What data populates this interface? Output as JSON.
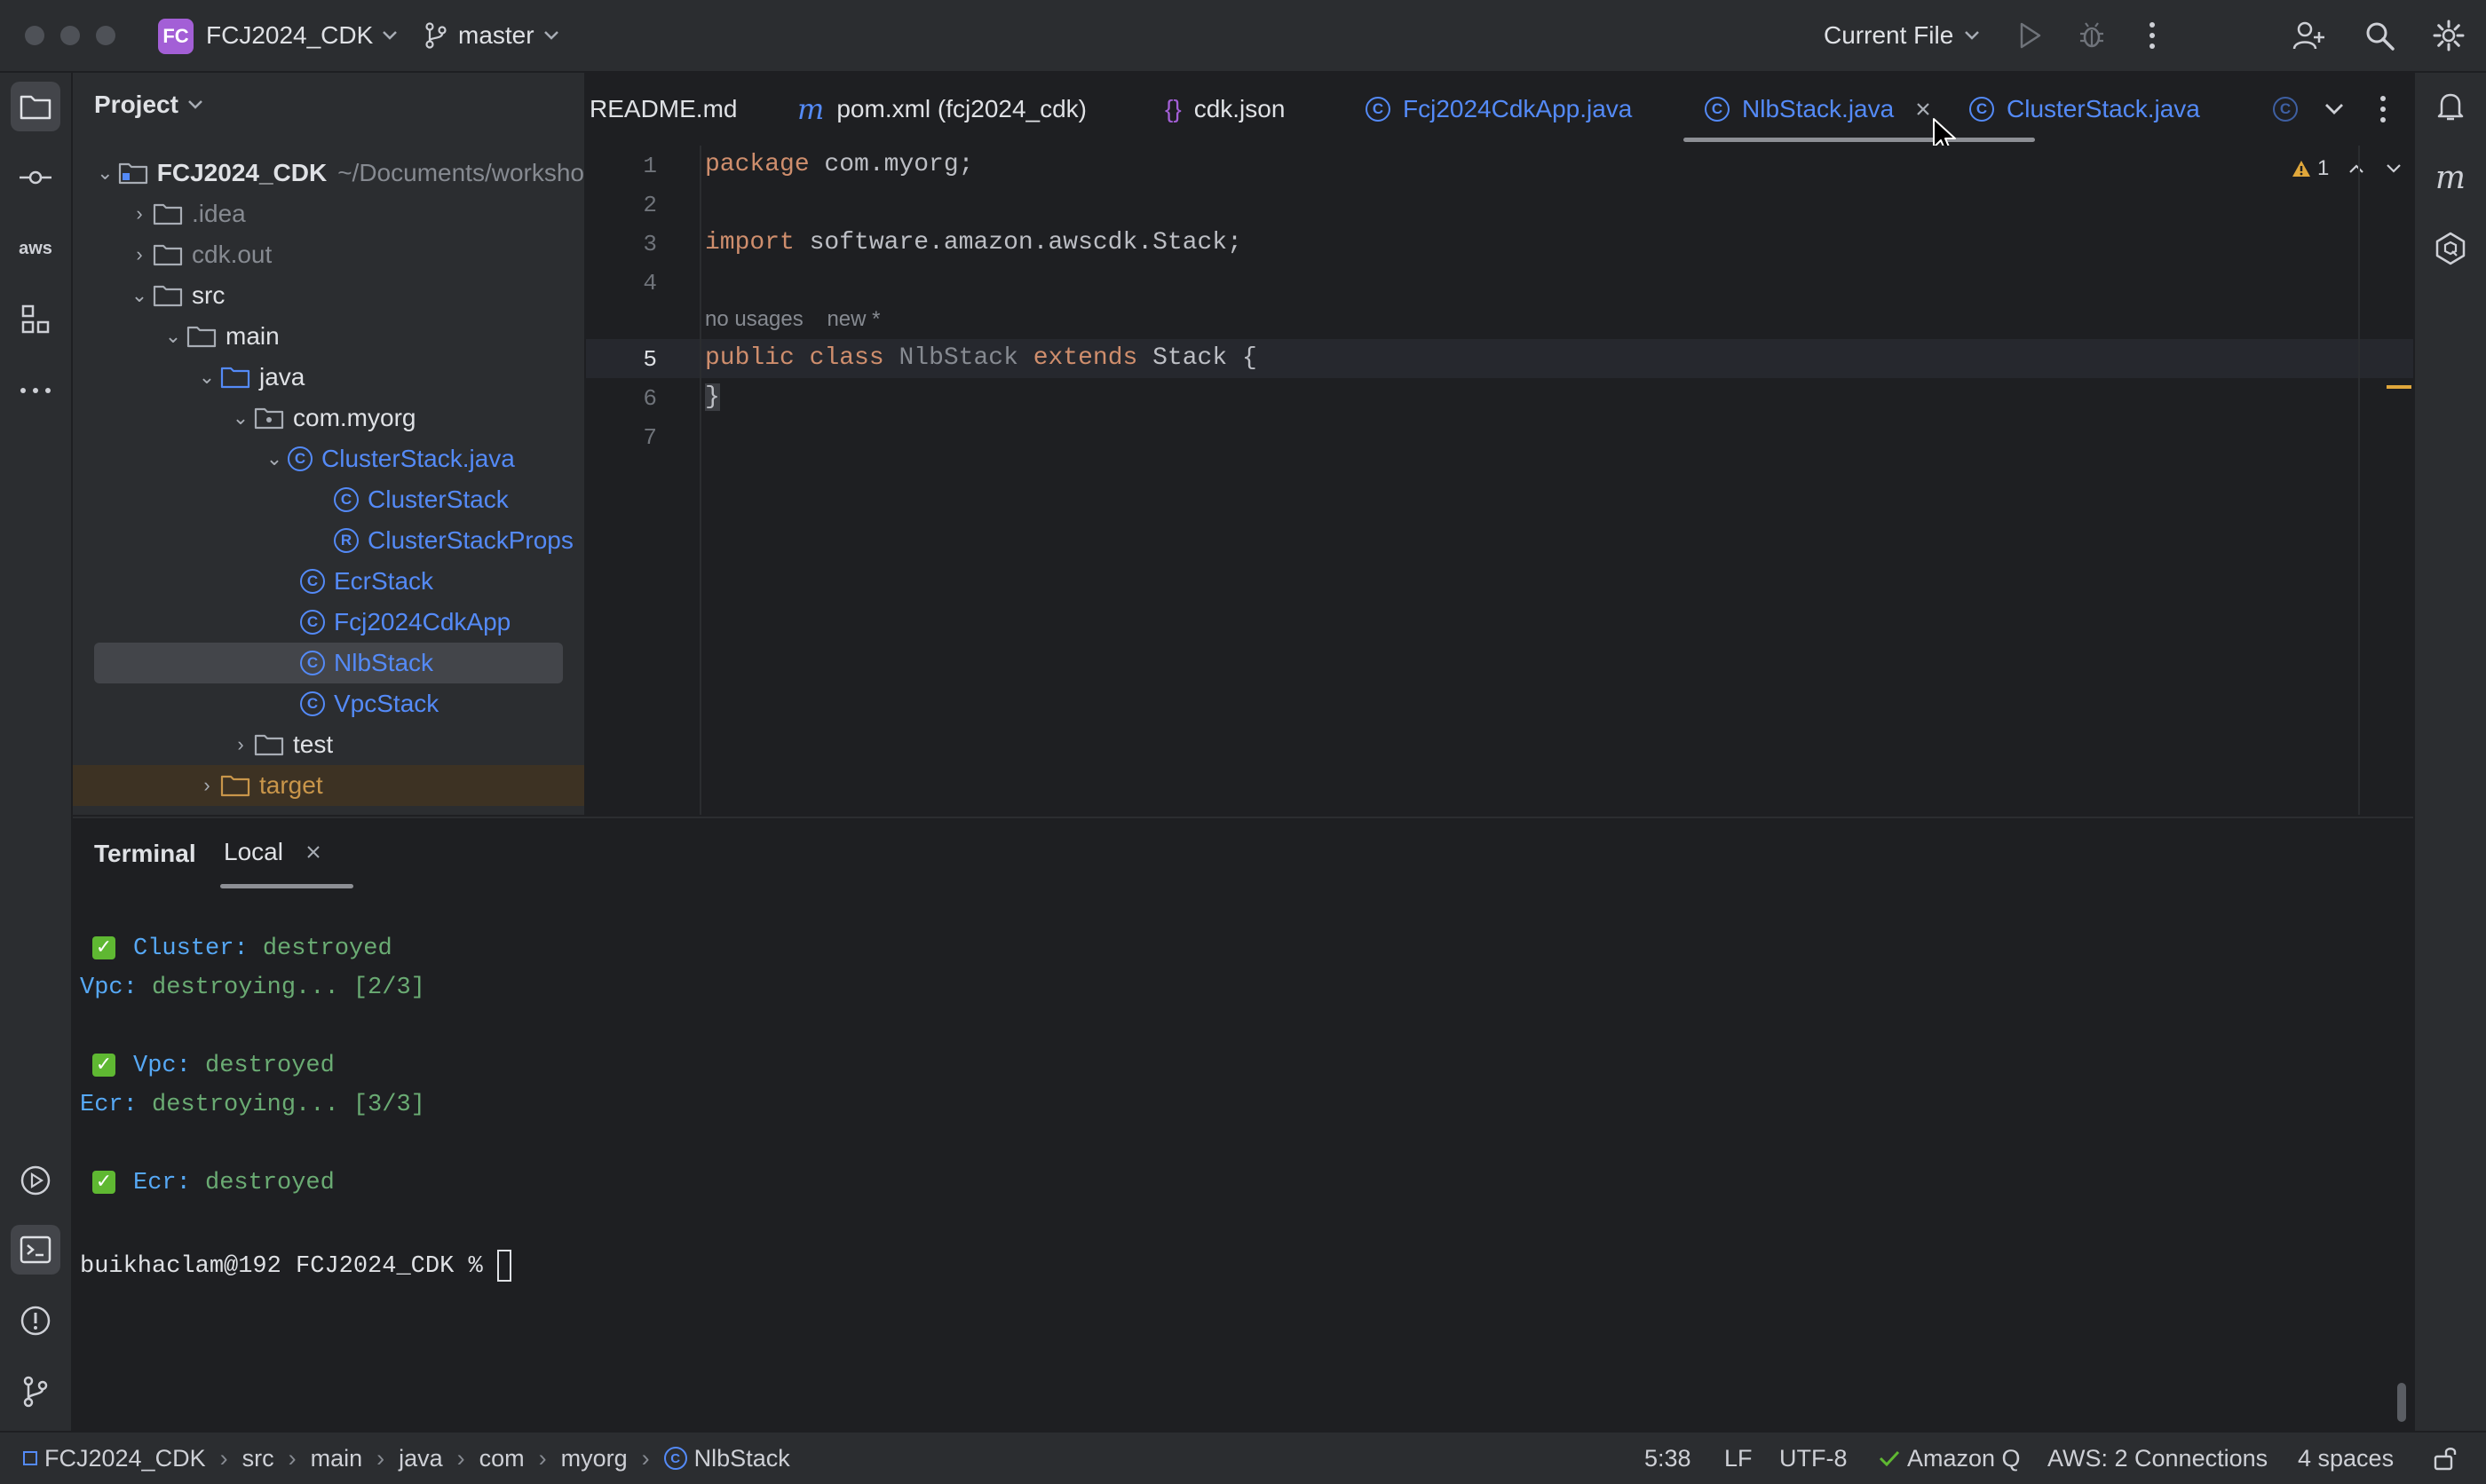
{
  "titlebar": {
    "project_badge": "FC",
    "project_name": "FCJ2024_CDK",
    "branch": "master",
    "run_config": "Current File"
  },
  "project_panel": {
    "title": "Project",
    "root_name": "FCJ2024_CDK",
    "root_path": "~/Documents/worksho",
    "items": [
      {
        "label": ".idea"
      },
      {
        "label": "cdk.out"
      },
      {
        "label": "src"
      },
      {
        "label": "main"
      },
      {
        "label": "java"
      },
      {
        "label": "com.myorg"
      },
      {
        "label": "ClusterStack.java"
      },
      {
        "label": "ClusterStack"
      },
      {
        "label": "ClusterStackProps"
      },
      {
        "label": "EcrStack"
      },
      {
        "label": "Fcj2024CdkApp"
      },
      {
        "label": "NlbStack"
      },
      {
        "label": "VpcStack"
      },
      {
        "label": "test"
      },
      {
        "label": "target"
      }
    ]
  },
  "tabs": [
    {
      "label": "README.md"
    },
    {
      "label": "pom.xml (fcj2024_cdk)"
    },
    {
      "label": "cdk.json"
    },
    {
      "label": "Fcj2024CdkApp.java"
    },
    {
      "label": "NlbStack.java"
    },
    {
      "label": "ClusterStack.java"
    }
  ],
  "editor": {
    "line_numbers": [
      "1",
      "2",
      "3",
      "4",
      "5",
      "6",
      "7"
    ],
    "code": {
      "l1_kw": "package",
      "l1_rest": " com.myorg;",
      "l3_kw": "import",
      "l3_rest": " software.amazon.awscdk.Stack;",
      "l5_kw1": "public",
      "l5_kw2": "class",
      "l5_name": "NlbStack",
      "l5_kw3": "extends",
      "l5_rest": " Stack {",
      "l6": "}"
    },
    "hint_usages": "no usages",
    "hint_new": "new *",
    "warning_count": "1"
  },
  "terminal": {
    "title": "Terminal",
    "tab_local": "Local",
    "lines": {
      "cluster_name": "Cluster:",
      "cluster_status": " destroyed",
      "vpc_progress_name": "Vpc:",
      "vpc_progress": " destroying... [2/3]",
      "vpc_name": "Vpc:",
      "vpc_status": " destroyed",
      "ecr_progress_name": "Ecr:",
      "ecr_progress": " destroying... [3/3]",
      "ecr_name": "Ecr:",
      "ecr_status": " destroyed",
      "prompt": "buikhaclam@192 FCJ2024_CDK % "
    }
  },
  "statusbar": {
    "breadcrumb": [
      "FCJ2024_CDK",
      "src",
      "main",
      "java",
      "com",
      "myorg",
      "NlbStack"
    ],
    "position": "5:38",
    "line_sep": "LF",
    "encoding": "UTF-8",
    "amazon_q": "Amazon Q",
    "aws": "AWS: 2 Connections",
    "indent": "4 spaces"
  },
  "colors": {
    "accent_blue": "#548af7",
    "keyword": "#cf8e6d",
    "terminal_green": "#6aab73",
    "terminal_blue": "#56a8f5"
  }
}
